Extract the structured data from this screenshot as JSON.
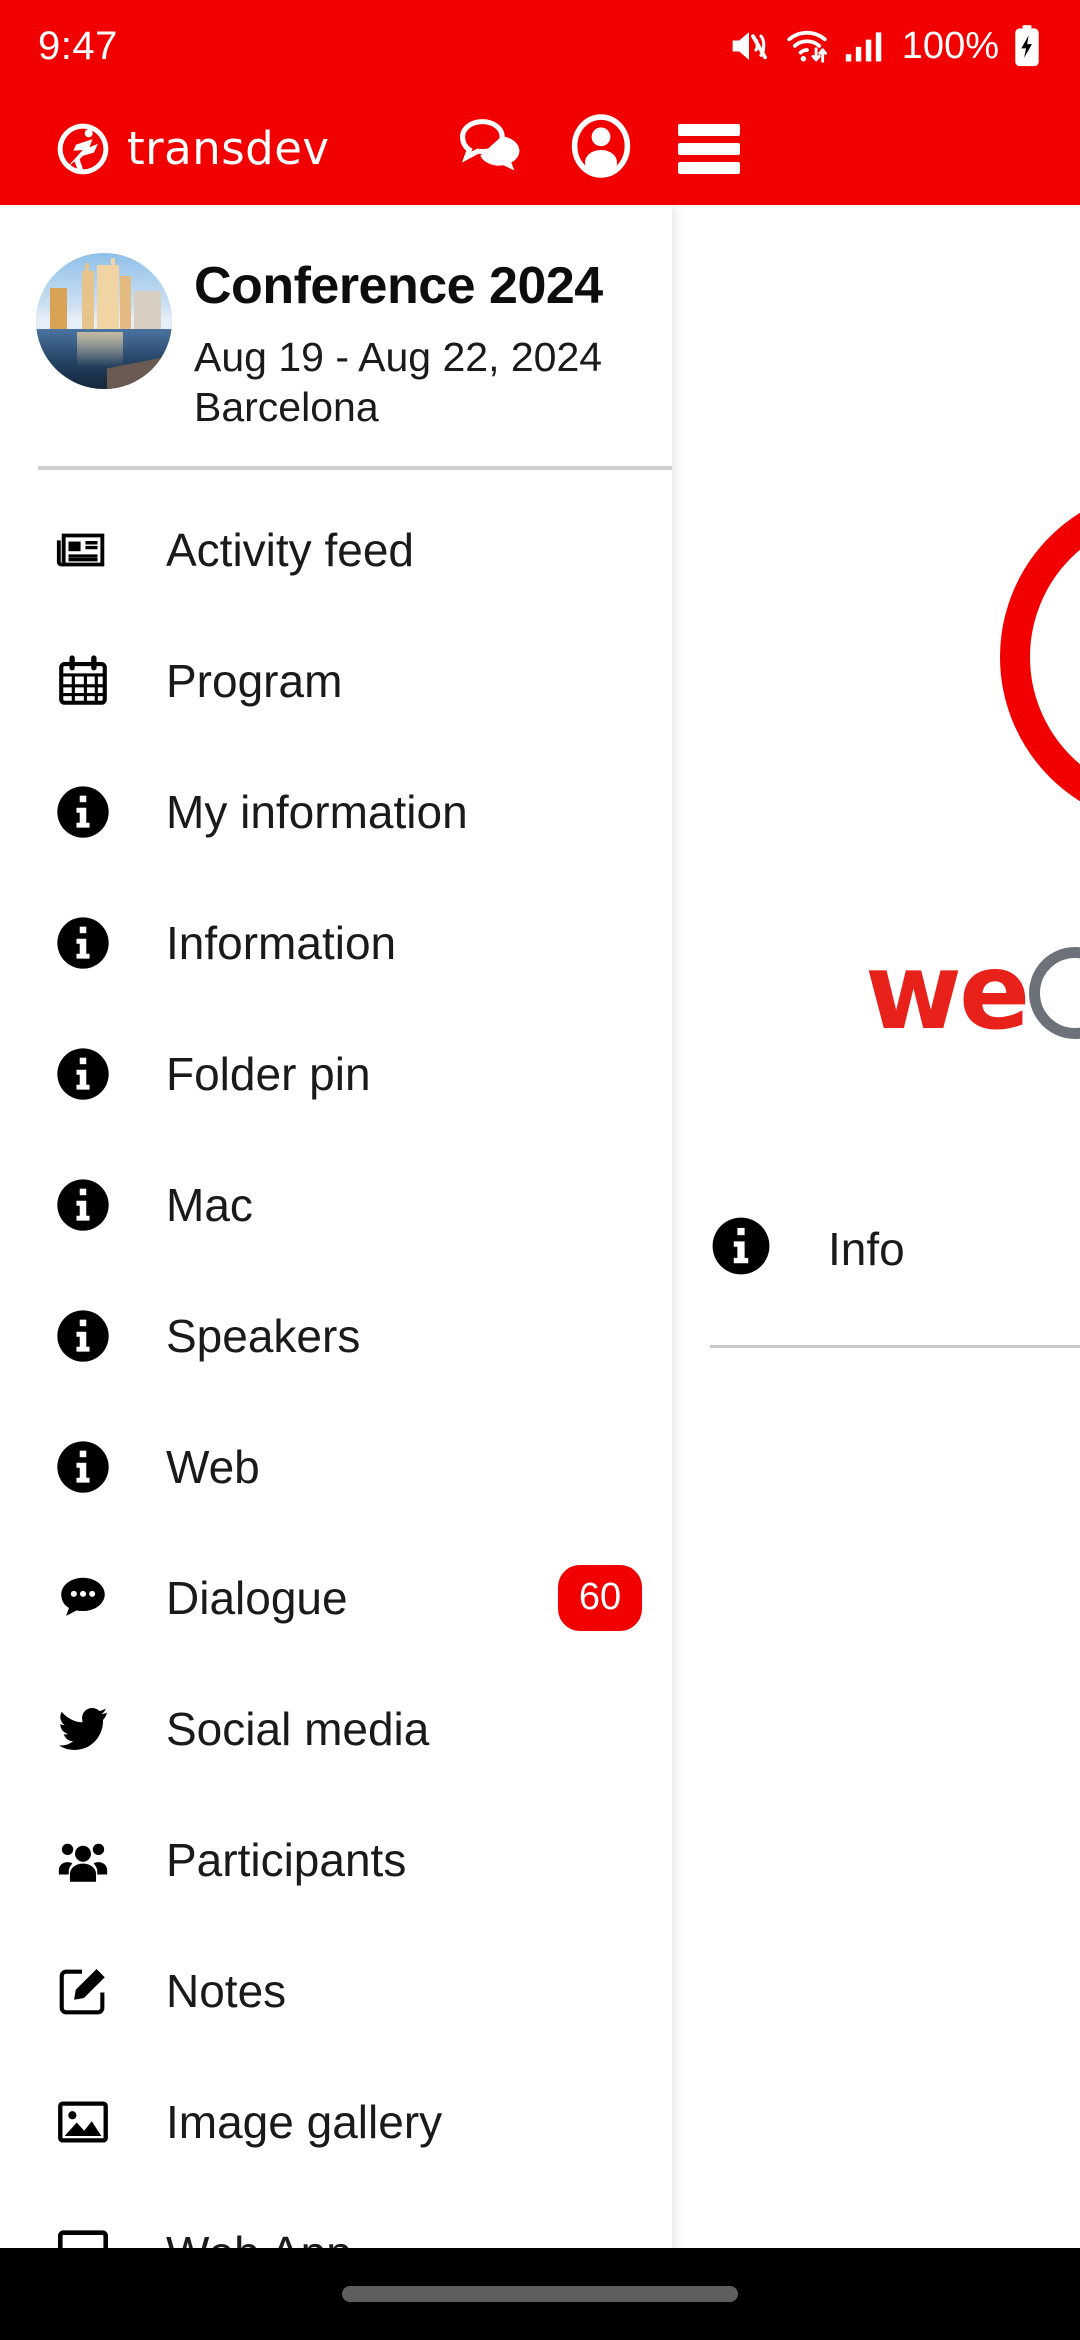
{
  "theme": {
    "brand_red": "#f20000",
    "badge_red": "#f20000",
    "text_dark": "#1a1a1a",
    "divider": "#cfcfcf",
    "navbar_black": "#000000"
  },
  "status_bar": {
    "clock": "9:47",
    "battery_percent": "100%",
    "icons": [
      "mute-vibrate-icon",
      "wifi-icon",
      "cellular-signal-icon",
      "battery-charging-icon"
    ]
  },
  "app_bar": {
    "brand_name": "transdev",
    "brand_mark": "transdev-logo-icon",
    "actions": [
      {
        "name": "chat-icon",
        "label": "Chat"
      },
      {
        "name": "account-icon",
        "label": "Account"
      },
      {
        "name": "menu-icon",
        "label": "Menu"
      }
    ]
  },
  "drawer": {
    "event": {
      "title": "Conference 2024",
      "dates": "Aug 19 - Aug 22, 2024",
      "city": "Barcelona",
      "avatar": "city-skyline-photo"
    },
    "menu": [
      {
        "label": "Activity feed",
        "icon": "newspaper-icon",
        "badge": null
      },
      {
        "label": "Program",
        "icon": "calendar-icon",
        "badge": null
      },
      {
        "label": "My information",
        "icon": "info-circle-icon",
        "badge": null
      },
      {
        "label": "Information",
        "icon": "info-circle-icon",
        "badge": null
      },
      {
        "label": "Folder pin",
        "icon": "info-circle-icon",
        "badge": null
      },
      {
        "label": "Mac",
        "icon": "info-circle-icon",
        "badge": null
      },
      {
        "label": "Speakers",
        "icon": "info-circle-icon",
        "badge": null
      },
      {
        "label": "Web",
        "icon": "info-circle-icon",
        "badge": null
      },
      {
        "label": "Dialogue",
        "icon": "chat-bubble-icon",
        "badge": "60"
      },
      {
        "label": "Social media",
        "icon": "twitter-bird-icon",
        "badge": null
      },
      {
        "label": "Participants",
        "icon": "people-group-icon",
        "badge": null
      },
      {
        "label": "Notes",
        "icon": "note-edit-icon",
        "badge": null
      },
      {
        "label": "Image gallery",
        "icon": "image-icon",
        "badge": null
      },
      {
        "label": "Web App",
        "icon": "monitor-icon",
        "badge": null
      }
    ]
  },
  "background_page": {
    "logo_text": "we",
    "logo_ring": "circle-outline-icon",
    "decor_ring": "large-red-ring",
    "info_row": {
      "label": "Info",
      "icon": "info-circle-icon"
    }
  },
  "nav_bar": {
    "gesture_pill": "home-gesture-pill"
  }
}
